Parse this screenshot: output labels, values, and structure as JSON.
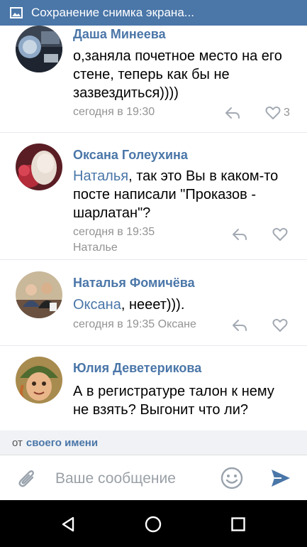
{
  "status_bar": {
    "title": "Сохранение снимка экрана..."
  },
  "comments": [
    {
      "author": "Даша Минеева",
      "text": "о,заняла почетное место на его стене, теперь как бы не зазвездиться))))",
      "time": "сегодня в 19:30",
      "likes": "3"
    },
    {
      "author": "Оксана Голеухина",
      "mention": "Наталья",
      "text": ", так это Вы в каком-то посте написали \"Проказов - шарлатан\"?",
      "time": "сегодня в 19:35",
      "reply_to": "Наталье"
    },
    {
      "author": "Наталья Фомичёва",
      "mention": "Оксана",
      "text": ", нееет))).",
      "time": "сегодня в 19:35",
      "reply_to": "Оксане"
    },
    {
      "author": "Юлия Деветерикова",
      "text": "А в регистратуре талон к нему не взять? Выгонит что ли?"
    }
  ],
  "composer": {
    "from_label": "от",
    "from_link": "своего имени",
    "placeholder": "Ваше сообщение"
  },
  "icons": {
    "status": "image-icon",
    "reply": "reply-icon",
    "like": "heart-icon",
    "attach": "paperclip-icon",
    "emoji": "smile-icon",
    "send": "send-icon",
    "nav": [
      "back-icon",
      "home-icon",
      "recent-apps-icon"
    ]
  },
  "colors": {
    "accent": "#4a76a8",
    "meta": "#939393",
    "status_bar": "#4a76a8"
  }
}
